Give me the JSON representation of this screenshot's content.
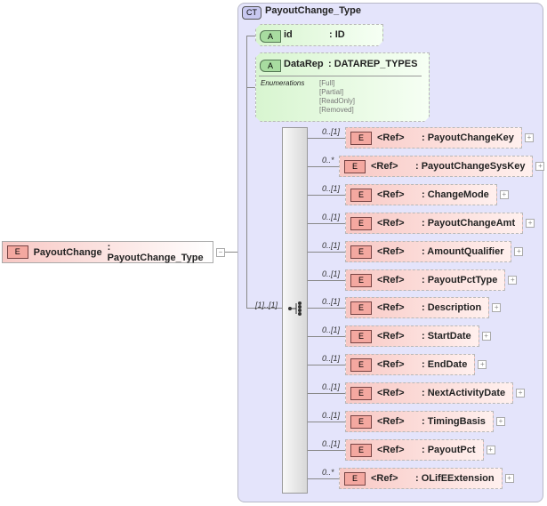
{
  "root": {
    "badge": "E",
    "name": "PayoutChange",
    "type": ": PayoutChange_Type",
    "toggle": "−"
  },
  "complex_type": {
    "badge": "CT",
    "title": "PayoutChange_Type"
  },
  "attributes": [
    {
      "badge": "A",
      "name": "id",
      "type": ": ID"
    },
    {
      "badge": "A",
      "name": "DataRep",
      "type": ": DATAREP_TYPES",
      "enum_label": "Enumerations",
      "enums": [
        "[Full]",
        "[Partial]",
        "[ReadOnly]",
        "[Removed]"
      ]
    }
  ],
  "sequence": {
    "multiplicity": "[1]..[1]"
  },
  "elements": [
    {
      "mult": "0..[1]",
      "ref": "<Ref>",
      "name": ": PayoutChangeKey"
    },
    {
      "mult": "0..*",
      "ref": "<Ref>",
      "name": ": PayoutChangeSysKey"
    },
    {
      "mult": "0..[1]",
      "ref": "<Ref>",
      "name": ": ChangeMode"
    },
    {
      "mult": "0..[1]",
      "ref": "<Ref>",
      "name": ": PayoutChangeAmt"
    },
    {
      "mult": "0..[1]",
      "ref": "<Ref>",
      "name": ": AmountQualifier"
    },
    {
      "mult": "0..[1]",
      "ref": "<Ref>",
      "name": ": PayoutPctType"
    },
    {
      "mult": "0..[1]",
      "ref": "<Ref>",
      "name": ": Description"
    },
    {
      "mult": "0..[1]",
      "ref": "<Ref>",
      "name": ": StartDate"
    },
    {
      "mult": "0..[1]",
      "ref": "<Ref>",
      "name": ": EndDate"
    },
    {
      "mult": "0..[1]",
      "ref": "<Ref>",
      "name": ": NextActivityDate"
    },
    {
      "mult": "0..[1]",
      "ref": "<Ref>",
      "name": ": TimingBasis"
    },
    {
      "mult": "0..[1]",
      "ref": "<Ref>",
      "name": ": PayoutPct"
    },
    {
      "mult": "0..*",
      "ref": "<Ref>",
      "name": ": OLifEExtension"
    }
  ],
  "element_badge": "E",
  "expand": "+"
}
